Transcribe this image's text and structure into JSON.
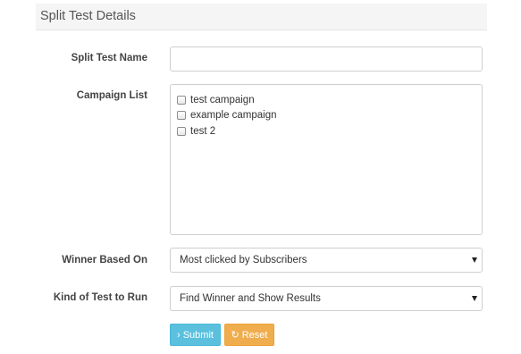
{
  "panel": {
    "title": "Split Test Details"
  },
  "form": {
    "name": {
      "label": "Split Test Name",
      "value": ""
    },
    "campaigns": {
      "label": "Campaign List",
      "items": [
        {
          "label": "test campaign",
          "checked": false
        },
        {
          "label": "example campaign",
          "checked": false
        },
        {
          "label": "test 2",
          "checked": false
        }
      ]
    },
    "winner": {
      "label": "Winner Based On",
      "selected": "Most clicked by Subscribers"
    },
    "kind": {
      "label": "Kind of Test to Run",
      "selected": "Find Winner and Show Results"
    }
  },
  "actions": {
    "submit": {
      "icon": "›",
      "icon_name": "chevron-right-icon",
      "label": "Submit"
    },
    "reset": {
      "icon": "↻",
      "icon_name": "refresh-icon",
      "label": "Reset"
    }
  },
  "colors": {
    "submit": "#5bc0de",
    "reset": "#f0ad4e",
    "panel_heading": "#f5f5f5"
  }
}
